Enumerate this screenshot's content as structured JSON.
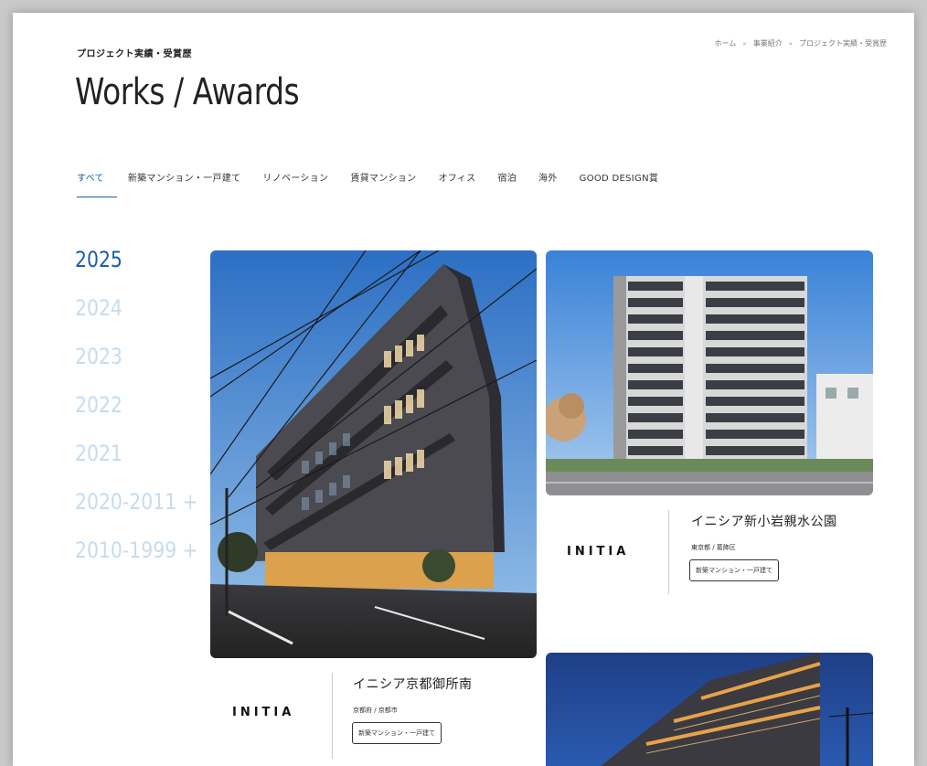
{
  "header": {
    "subtitle": "プロジェクト実績・受賞歴",
    "title": "Works / Awards"
  },
  "breadcrumb": {
    "items": [
      "ホーム",
      "事業紹介",
      "プロジェクト実績・受賞歴"
    ],
    "separator": "»"
  },
  "tabs": [
    "すべて",
    "新築マンション・一戸建て",
    "リノベーション",
    "賃貸マンション",
    "オフィス",
    "宿泊",
    "海外",
    "GOOD DESIGN賞"
  ],
  "years": [
    "2025",
    "2024",
    "2023",
    "2022",
    "2021",
    "2020-2011 +",
    "2010-1999 +"
  ],
  "projects": [
    {
      "brand": "INITIA",
      "name": "イニシア京都御所南",
      "location": "京都府 / 京都市",
      "tag": "新築マンション・一戸建て"
    },
    {
      "brand": "INITIA",
      "name": "イニシア新小岩親水公園",
      "location": "東京都 / 葛飾区",
      "tag": "新築マンション・一戸建て"
    }
  ],
  "colors": {
    "accent": "#1a5fa6",
    "year_inactive": "#c5dcee"
  }
}
